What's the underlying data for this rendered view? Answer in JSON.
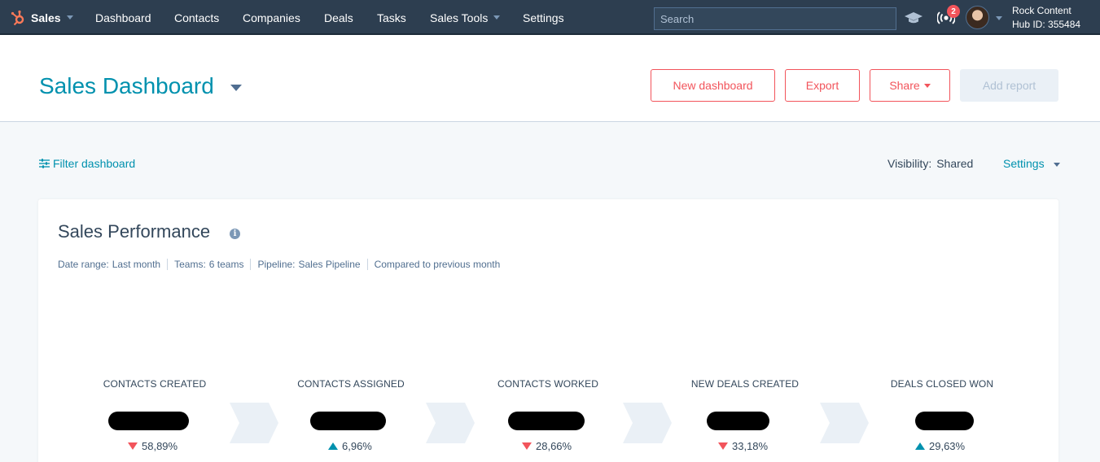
{
  "nav": {
    "brand": "Sales",
    "items": [
      "Dashboard",
      "Contacts",
      "Companies",
      "Deals",
      "Tasks",
      "Sales Tools",
      "Settings"
    ],
    "search_placeholder": "Search",
    "notification_count": "2",
    "account_name": "Rock Content",
    "hub_id": "Hub ID: 355484"
  },
  "header": {
    "title": "Sales Dashboard",
    "buttons": {
      "new_dashboard": "New dashboard",
      "export": "Export",
      "share": "Share",
      "add_report": "Add report"
    }
  },
  "toolbar": {
    "filter": "Filter dashboard",
    "visibility_label": "Visibility:",
    "visibility_value": "Shared",
    "settings": "Settings"
  },
  "card": {
    "title": "Sales Performance",
    "meta": [
      {
        "label": "Date range:",
        "value": "Last month"
      },
      {
        "label": "Teams:",
        "value": "6 teams"
      },
      {
        "label": "Pipeline:",
        "value": "Sales Pipeline"
      },
      {
        "label": "Compared to previous month",
        "value": ""
      }
    ],
    "stages": [
      {
        "label": "CONTACTS CREATED",
        "change": "58,89%",
        "direction": "down"
      },
      {
        "label": "CONTACTS ASSIGNED",
        "change": "6,96%",
        "direction": "up"
      },
      {
        "label": "CONTACTS WORKED",
        "change": "28,66%",
        "direction": "down"
      },
      {
        "label": "NEW DEALS CREATED",
        "change": "33,18%",
        "direction": "down"
      },
      {
        "label": "DEALS CLOSED WON",
        "change": "29,63%",
        "direction": "up"
      }
    ]
  },
  "colors": {
    "nav_bg": "#2d3e50",
    "accent_teal": "#0091ae",
    "accent_coral": "#f2545b",
    "text_dark": "#33475b"
  }
}
